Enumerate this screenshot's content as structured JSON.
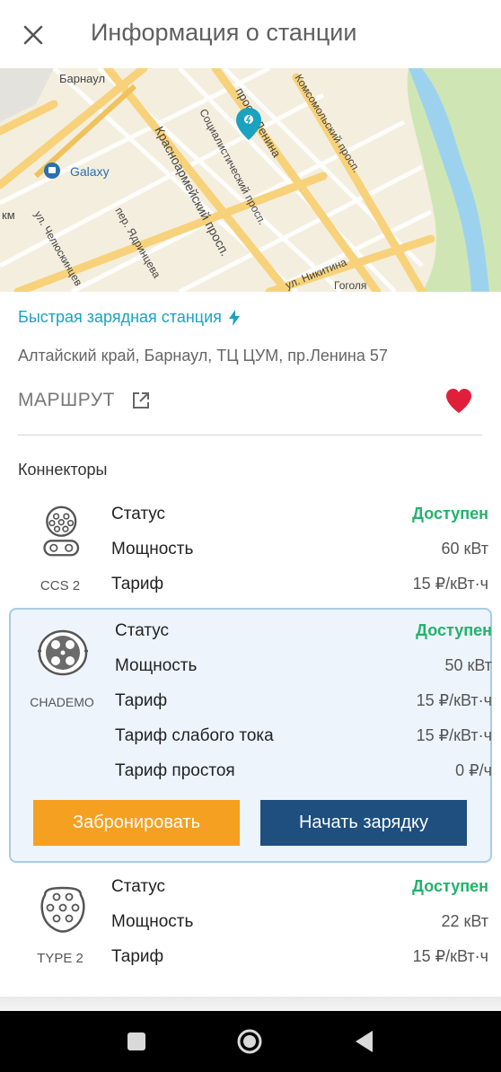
{
  "header": {
    "title": "Информация о станции"
  },
  "map": {
    "labels": {
      "city": "Барнаул",
      "galaxy": "Galaxy",
      "km": "км",
      "krasnoarmeisky": "Красноармейский просп.",
      "sotsialistichesky": "Социалистический просп.",
      "lenina": "просп. Ленина",
      "komsomolsky": "Комсомольский просп.",
      "chelyuskintsev": "ул. Челюскинцев",
      "yadrintseva": "пер. Ядринцева",
      "nikitina": "ул. Никитина",
      "gola": "Гоголя"
    }
  },
  "station": {
    "type": "Быстрая зарядная станция",
    "address": "Алтайский край, Барнаул, ТЦ ЦУМ, пр.Ленина 57",
    "route_label": "МАРШРУТ"
  },
  "connectors_title": "Коннекторы",
  "connectors": [
    {
      "name": "CCS 2",
      "rows": [
        {
          "label": "Статус",
          "value": "Доступен"
        },
        {
          "label": "Мощность",
          "value": "60 кВт"
        },
        {
          "label": "Тариф",
          "value": "15 ₽/кВт·ч"
        }
      ]
    },
    {
      "name": "CHADEMO",
      "rows": [
        {
          "label": "Статус",
          "value": "Доступен"
        },
        {
          "label": "Мощность",
          "value": "50 кВт"
        },
        {
          "label": "Тариф",
          "value": "15 ₽/кВт·ч"
        },
        {
          "label": "Тариф слабого тока",
          "value": "15 ₽/кВт·ч"
        },
        {
          "label": "Тариф простоя",
          "value": "0 ₽/ч"
        }
      ],
      "buttons": {
        "reserve": "Забронировать",
        "start": "Начать зарядку"
      }
    },
    {
      "name": "TYPE 2",
      "rows": [
        {
          "label": "Статус",
          "value": "Доступен"
        },
        {
          "label": "Мощность",
          "value": "22 кВт"
        },
        {
          "label": "Тариф",
          "value": "15 ₽/кВт·ч"
        }
      ]
    }
  ],
  "colors": {
    "accent": "#1aa3c0",
    "available": "#22b36a",
    "favorite": "#e0203a",
    "reserve_button": "#f6a021",
    "start_button": "#1e4f7e"
  }
}
